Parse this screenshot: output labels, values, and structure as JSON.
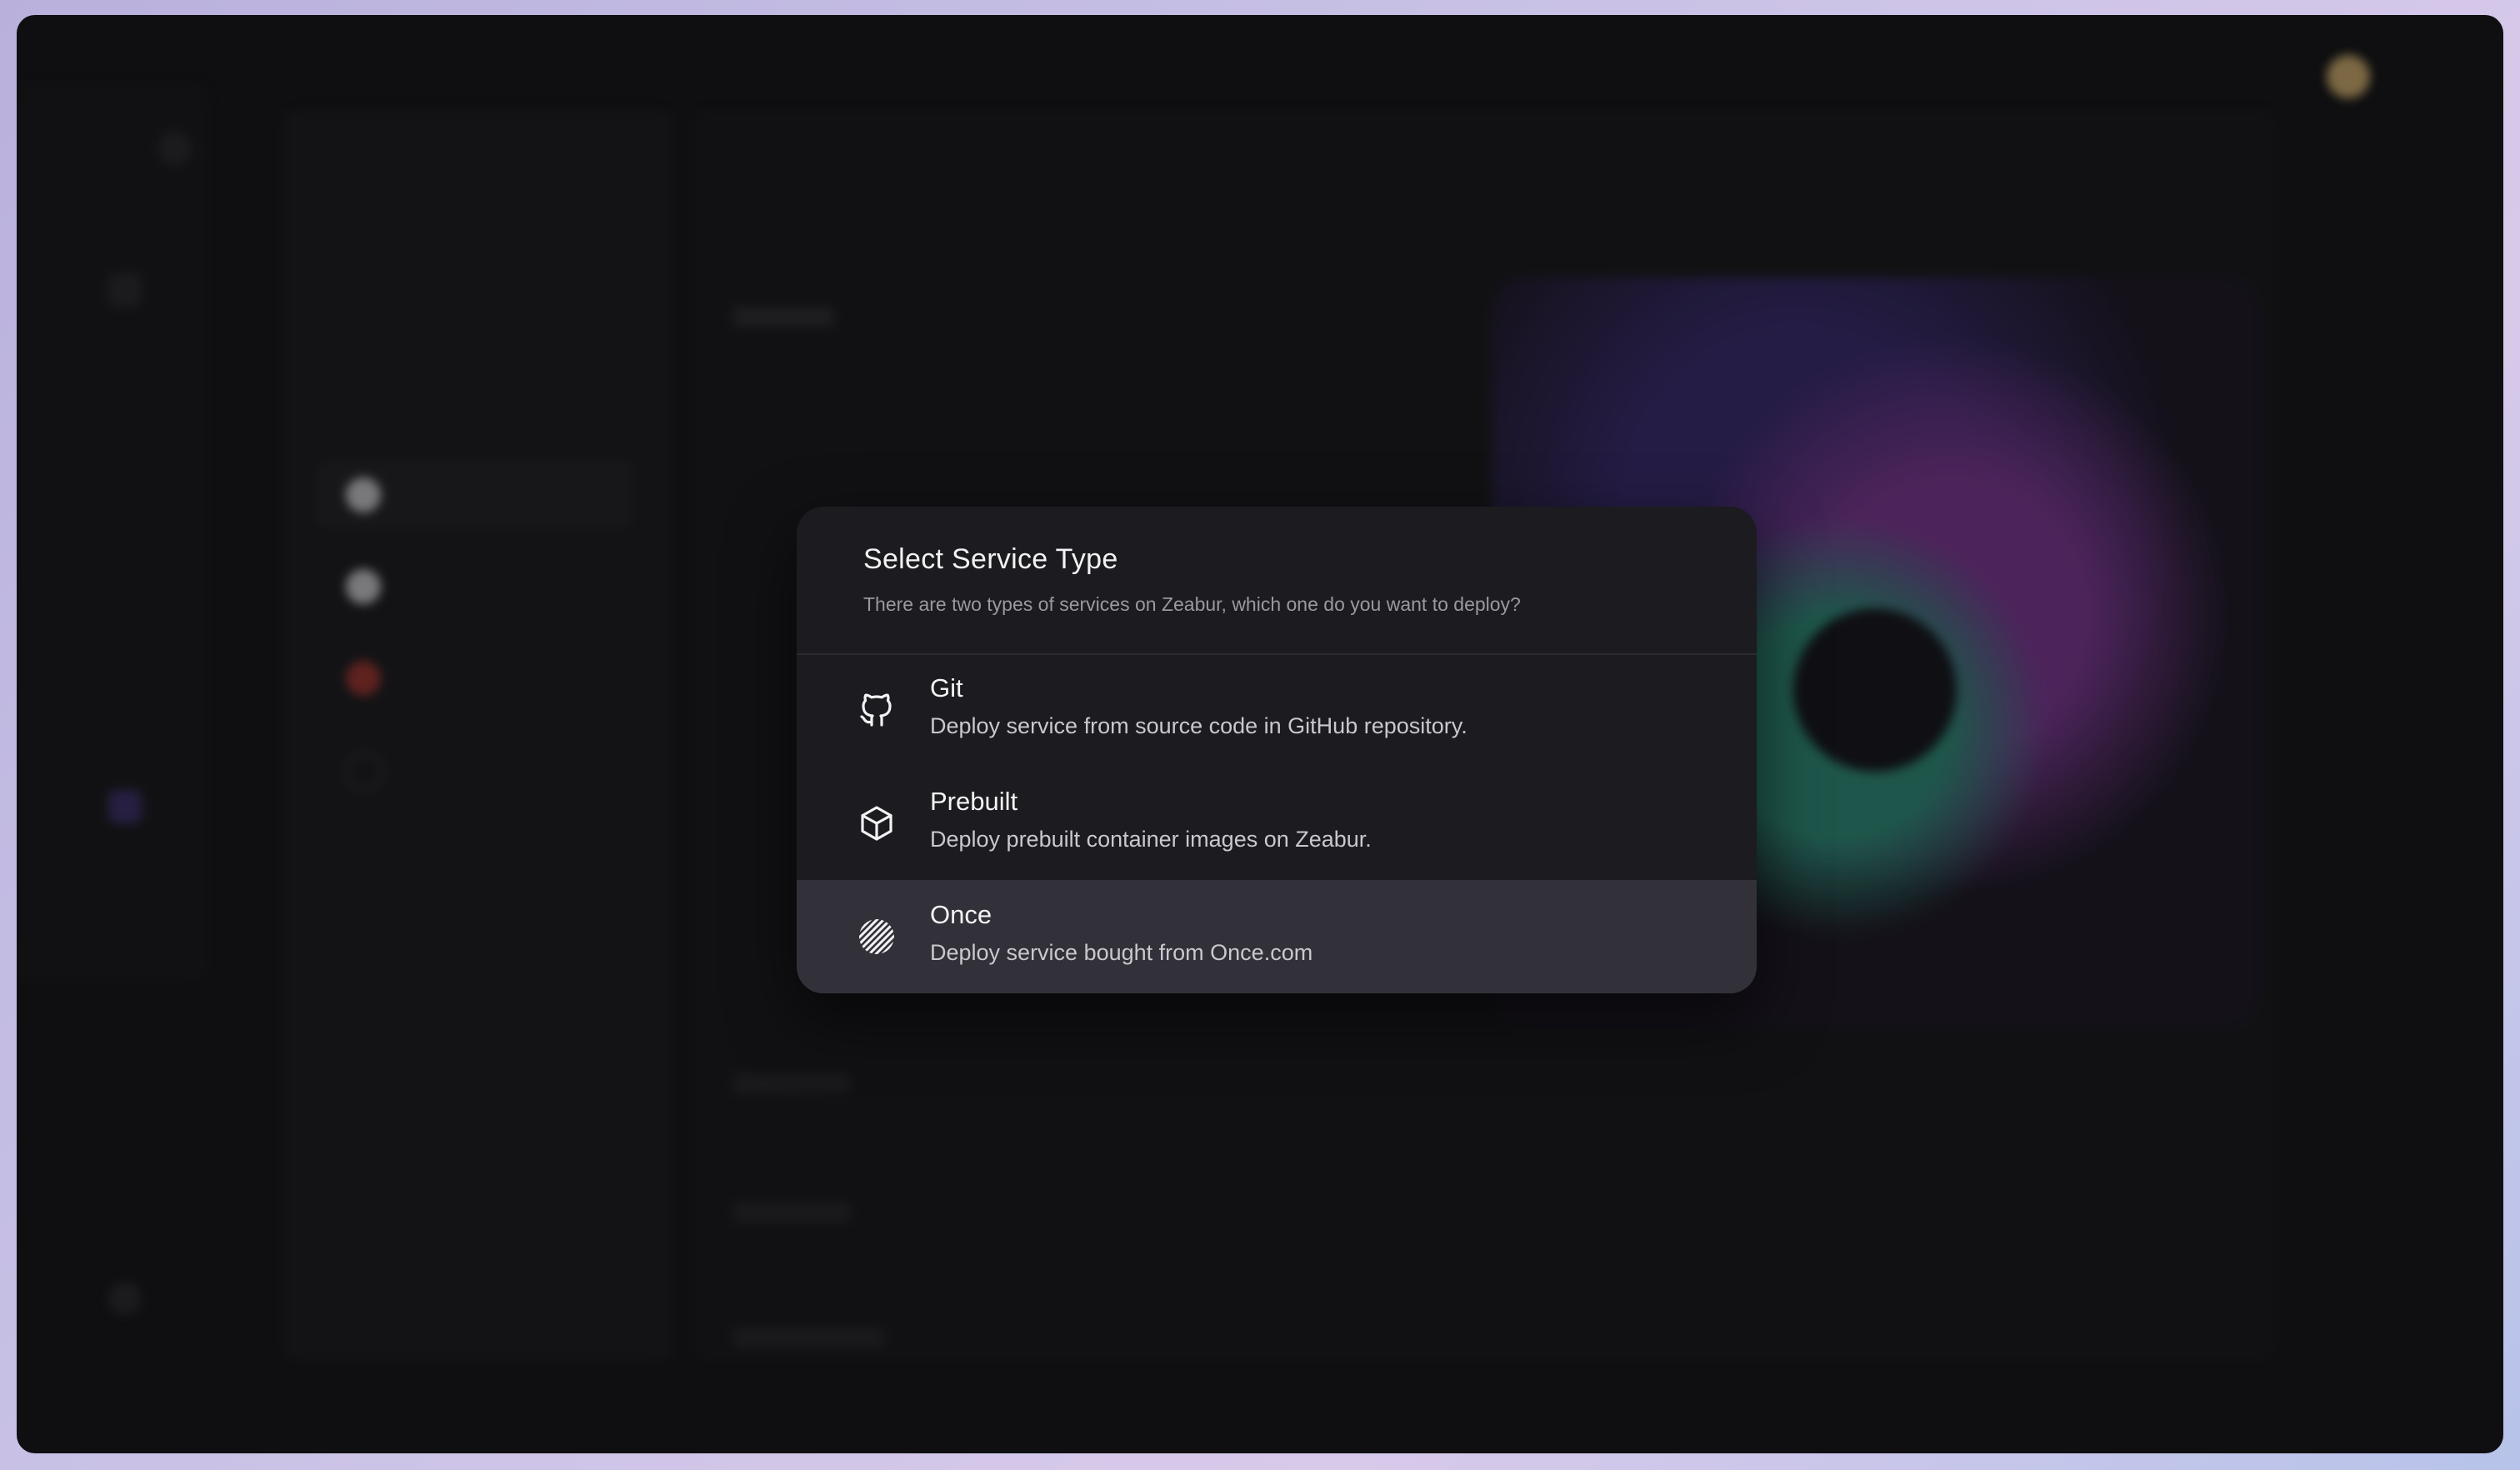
{
  "modal": {
    "title": "Select Service Type",
    "subtitle": "There are two types of services on Zeabur, which one do you want to deploy?",
    "options": [
      {
        "title": "Git",
        "description": "Deploy service from source code in GitHub repository.",
        "icon": "github-icon",
        "selected": false
      },
      {
        "title": "Prebuilt",
        "description": "Deploy prebuilt container images on Zeabur.",
        "icon": "cube-icon",
        "selected": false
      },
      {
        "title": "Once",
        "description": "Deploy service bought from Once.com",
        "icon": "once-logo-icon",
        "selected": true
      }
    ]
  },
  "colors": {
    "modal_bg": "#1c1b1f",
    "selected_bg": "#323139",
    "backdrop": "#0f0f11"
  }
}
